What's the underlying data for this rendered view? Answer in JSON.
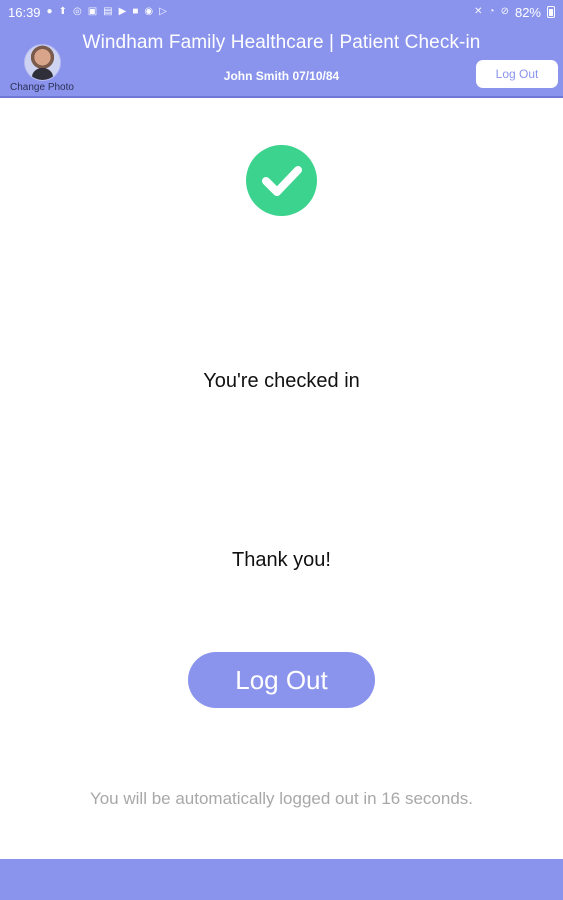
{
  "status_bar": {
    "time": "16:39",
    "battery": "82%",
    "left_icons": [
      "notification-icon",
      "upload-icon",
      "messenger-icon",
      "gallery-icon",
      "image-icon",
      "play-icon",
      "contacts-icon",
      "chrome-icon",
      "media-icon"
    ],
    "right_icons": [
      "mute-icon",
      "wifi-icon",
      "dnd-icon",
      "battery-icon"
    ]
  },
  "header": {
    "title": "Windham Family Healthcare | Patient Check-in",
    "patient": "John Smith 07/10/84",
    "change_photo_label": "Change Photo",
    "logout_label": "Log Out"
  },
  "main": {
    "checked_in": "You're checked in",
    "thank_you": "Thank you!",
    "logout_label": "Log Out",
    "auto_logout_message": "You will be automatically logged out in 16 seconds."
  },
  "colors": {
    "brand": "#8a94ec",
    "success": "#3cd38f",
    "muted_text": "#a8a8a8"
  }
}
